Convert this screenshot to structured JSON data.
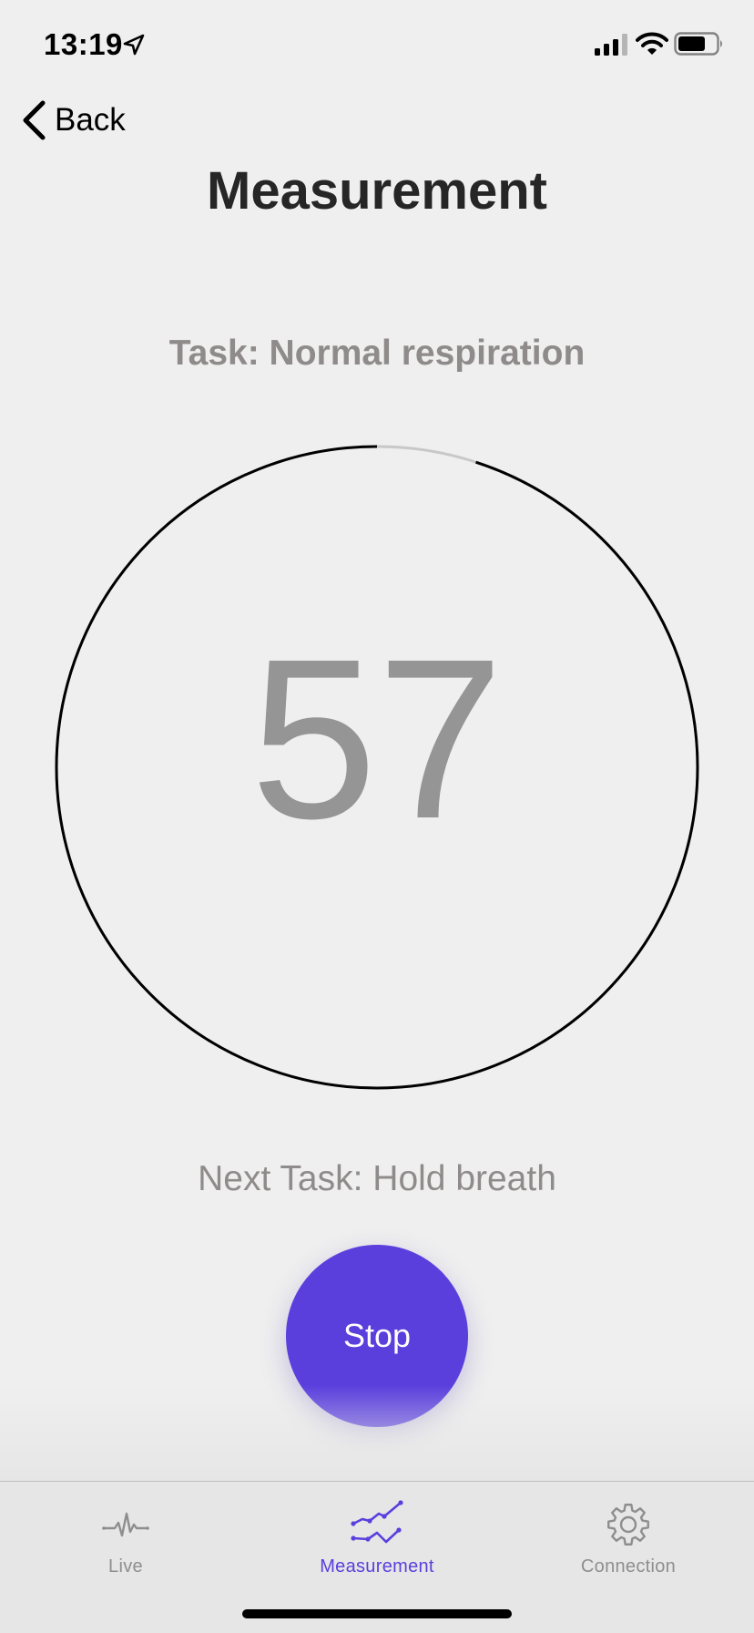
{
  "status_bar": {
    "time": "13:19",
    "icons": [
      "location-arrow-icon",
      "cellular-signal-icon",
      "wifi-icon",
      "battery-icon"
    ]
  },
  "nav": {
    "back_label": "Back",
    "title": "Measurement"
  },
  "task": {
    "current": "Task: Normal respiration",
    "next": "Next Task: Hold breath"
  },
  "timer": {
    "seconds_remaining": "57",
    "progress_elapsed_fraction": 0.05,
    "ring_color": "#000000",
    "track_color": "#c8c8c8"
  },
  "stop_button": {
    "label": "Stop",
    "color": "#5a3fdd"
  },
  "tab_bar": {
    "active_color": "#5a3fdd",
    "inactive_color": "#8e8e8e",
    "tabs": [
      {
        "label": "Live",
        "icon": "heartbeat-icon",
        "active": false
      },
      {
        "label": "Measurement",
        "icon": "line-chart-icon",
        "active": true
      },
      {
        "label": "Connection",
        "icon": "gear-icon",
        "active": false
      }
    ]
  }
}
